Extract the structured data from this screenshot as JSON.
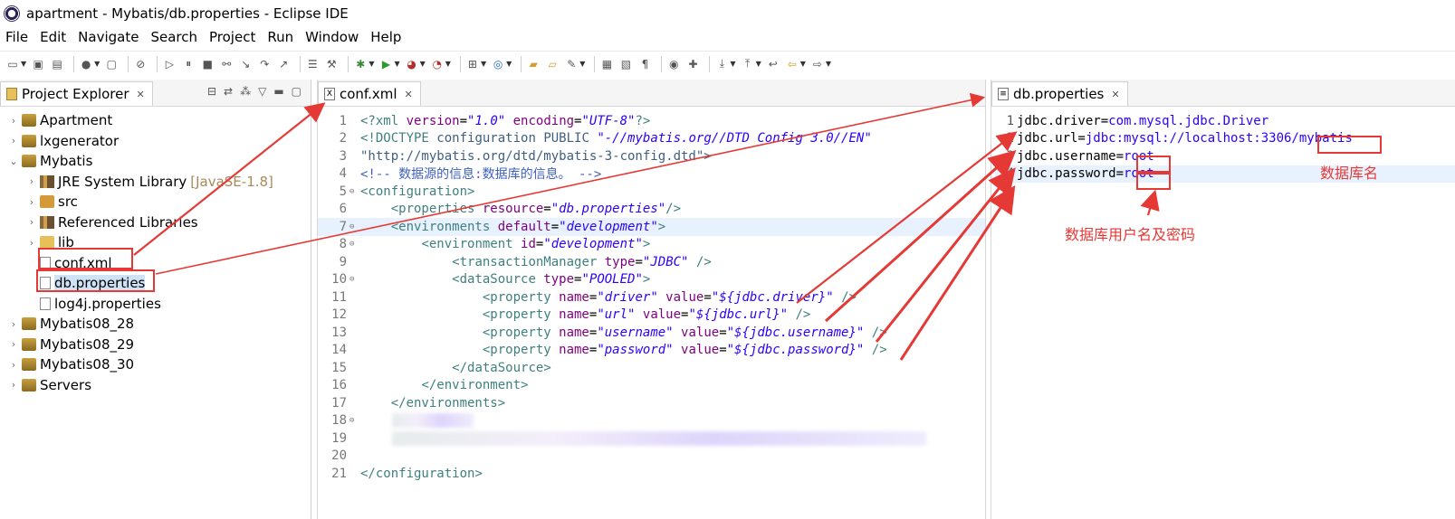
{
  "window": {
    "title": "apartment - Mybatis/db.properties - Eclipse IDE"
  },
  "menu": [
    "File",
    "Edit",
    "Navigate",
    "Search",
    "Project",
    "Run",
    "Window",
    "Help"
  ],
  "explorer": {
    "tab_label": "Project Explorer",
    "items": [
      {
        "label": "Apartment",
        "indent": 0,
        "expanded": false
      },
      {
        "label": "lxgenerator",
        "indent": 0,
        "expanded": false
      },
      {
        "label": "Mybatis",
        "indent": 0,
        "expanded": true
      },
      {
        "label": "JRE System Library",
        "extra": "[JavaSE-1.8]",
        "indent": 1,
        "expanded": false
      },
      {
        "label": "src",
        "indent": 1,
        "expanded": false
      },
      {
        "label": "Referenced Libraries",
        "indent": 1,
        "expanded": false
      },
      {
        "label": "lib",
        "indent": 1,
        "expanded": false
      },
      {
        "label": "conf.xml",
        "indent": 1,
        "leaf": true
      },
      {
        "label": "db.properties",
        "indent": 1,
        "leaf": true,
        "selected": true
      },
      {
        "label": "log4j.properties",
        "indent": 1,
        "leaf": true
      },
      {
        "label": "Mybatis08_28",
        "indent": 0,
        "expanded": false
      },
      {
        "label": "Mybatis08_29",
        "indent": 0,
        "expanded": false
      },
      {
        "label": "Mybatis08_30",
        "indent": 0,
        "expanded": false
      },
      {
        "label": "Servers",
        "indent": 0,
        "expanded": false
      }
    ]
  },
  "editor_conf": {
    "tab_label": "conf.xml",
    "lines": [
      {
        "n": "1",
        "code": "<?xml version=\"1.0\" encoding=\"UTF-8\"?>"
      },
      {
        "n": "2",
        "code": "<!DOCTYPE configuration PUBLIC \"-//mybatis.org//DTD Config 3.0//EN\""
      },
      {
        "n": "3",
        "code": "\"http://mybatis.org/dtd/mybatis-3-config.dtd\">"
      },
      {
        "n": "4",
        "code": "<!-- 数据源的信息:数据库的信息。 -->"
      },
      {
        "n": "5",
        "code": "<configuration>"
      },
      {
        "n": "6",
        "code": "    <properties resource=\"db.properties\"/>"
      },
      {
        "n": "7",
        "code": "    <environments default=\"development\">"
      },
      {
        "n": "8",
        "code": "        <environment id=\"development\">"
      },
      {
        "n": "9",
        "code": "            <transactionManager type=\"JDBC\" />"
      },
      {
        "n": "10",
        "code": "            <dataSource type=\"POOLED\">"
      },
      {
        "n": "11",
        "code": "                <property name=\"driver\" value=\"${jdbc.driver}\" />"
      },
      {
        "n": "12",
        "code": "                <property name=\"url\" value=\"${jdbc.url}\" />"
      },
      {
        "n": "13",
        "code": "                <property name=\"username\" value=\"${jdbc.username}\" />"
      },
      {
        "n": "14",
        "code": "                <property name=\"password\" value=\"${jdbc.password}\" />"
      },
      {
        "n": "15",
        "code": "            </dataSource>"
      },
      {
        "n": "16",
        "code": "        </environment>"
      },
      {
        "n": "17",
        "code": "    </environments>"
      },
      {
        "n": "18",
        "code": ""
      },
      {
        "n": "19",
        "code": ""
      },
      {
        "n": "20",
        "code": ""
      },
      {
        "n": "21",
        "code": "</configuration>"
      }
    ]
  },
  "editor_db": {
    "tab_label": "db.properties",
    "lines": [
      {
        "n": "1",
        "key": "jdbc.driver=",
        "value": "com.mysql.jdbc.Driver"
      },
      {
        "n": "2",
        "key": "jdbc.url=",
        "value": "jdbc:mysql://localhost:3306/mybatis"
      },
      {
        "n": "3",
        "key": "jdbc.username=",
        "value": "root"
      },
      {
        "n": "4",
        "key": "jdbc.password=",
        "value": "root"
      }
    ]
  },
  "annotations": {
    "db_name": "数据库名",
    "user_pass": "数据库用户名及密码"
  },
  "colors": {
    "annotation": "#e53935",
    "selection": "#cfe3f7",
    "highlight_line": "#e8f2fe"
  }
}
